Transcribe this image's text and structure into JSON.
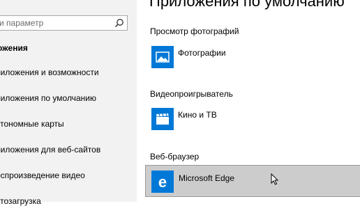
{
  "page": {
    "heading": "Приложения по умолчанию"
  },
  "search": {
    "placeholder": "и параметр"
  },
  "sidebar": {
    "section_title": "ожения",
    "items": [
      {
        "label": "риложения и возможности"
      },
      {
        "label": "риложения по умолчанию"
      },
      {
        "label": "втономные карты"
      },
      {
        "label": "риложения для веб-сайтов"
      },
      {
        "label": "оспроизведение видео"
      },
      {
        "label": "втозагрузка"
      }
    ]
  },
  "defaults": [
    {
      "group": "Просмотр фотографий",
      "app": "Фотографии",
      "icon": "photos-icon"
    },
    {
      "group": "Видеопроигрыватель",
      "app": "Кино и ТВ",
      "icon": "movies-tv-icon"
    },
    {
      "group": "Веб-браузер",
      "app": "Microsoft Edge",
      "icon": "edge-icon"
    }
  ],
  "colors": {
    "accent": "#0078d7",
    "sidebar_bg": "#f2f2f2",
    "selected_bg": "#cccccc"
  }
}
